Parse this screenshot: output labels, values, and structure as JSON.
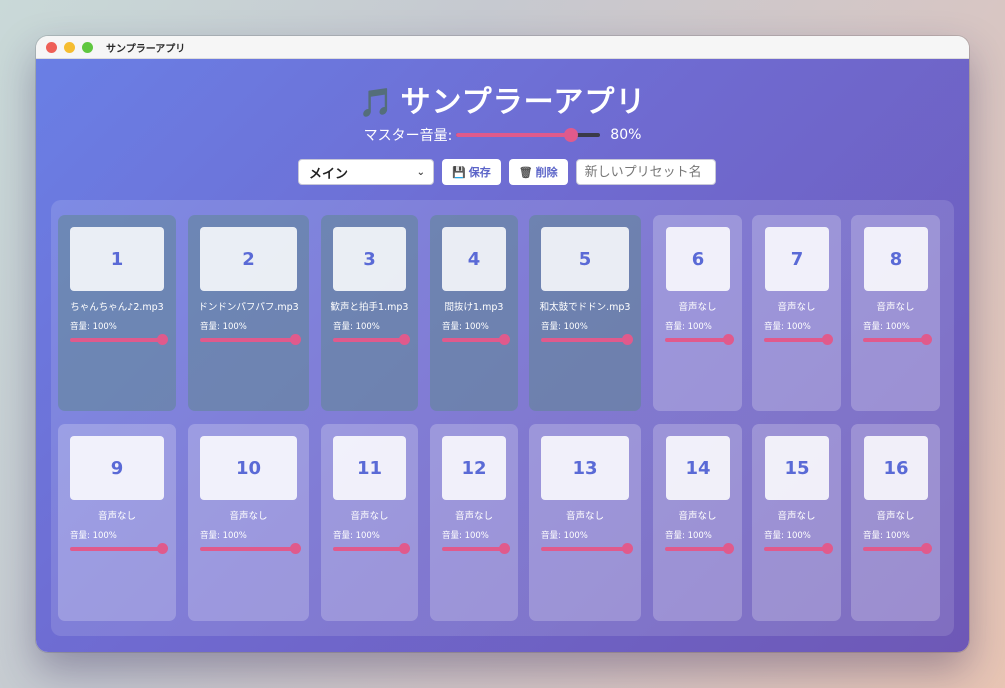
{
  "window": {
    "title": "サンプラーアプリ"
  },
  "app": {
    "title": "サンプラーアプリ",
    "icon": "musical-note-icon"
  },
  "master": {
    "label": "マスター音量:",
    "value_percent": 80,
    "value_text": "80%"
  },
  "toolbar": {
    "preset_selected": "メイン",
    "save_label": "保存",
    "delete_label": "削除",
    "new_preset_placeholder": "新しいプリセット名"
  },
  "colors": {
    "accent": "#e05a8c",
    "pad_number": "#5a6ad6"
  },
  "pads": [
    {
      "number": "1",
      "name": "ちゃんちゃん♪2.mp3",
      "volume_label": "音量: 100%",
      "volume": 100,
      "loaded": true
    },
    {
      "number": "2",
      "name": "ドンドンパフパフ.mp3",
      "volume_label": "音量: 100%",
      "volume": 100,
      "loaded": true
    },
    {
      "number": "3",
      "name": "歓声と拍手1.mp3",
      "volume_label": "音量: 100%",
      "volume": 100,
      "loaded": true
    },
    {
      "number": "4",
      "name": "間抜け1.mp3",
      "volume_label": "音量: 100%",
      "volume": 100,
      "loaded": true
    },
    {
      "number": "5",
      "name": "和太鼓でドドン.mp3",
      "volume_label": "音量: 100%",
      "volume": 100,
      "loaded": true
    },
    {
      "number": "6",
      "name": "音声なし",
      "volume_label": "音量: 100%",
      "volume": 100,
      "loaded": false
    },
    {
      "number": "7",
      "name": "音声なし",
      "volume_label": "音量: 100%",
      "volume": 100,
      "loaded": false
    },
    {
      "number": "8",
      "name": "音声なし",
      "volume_label": "音量: 100%",
      "volume": 100,
      "loaded": false
    },
    {
      "number": "9",
      "name": "音声なし",
      "volume_label": "音量: 100%",
      "volume": 100,
      "loaded": false
    },
    {
      "number": "10",
      "name": "音声なし",
      "volume_label": "音量: 100%",
      "volume": 100,
      "loaded": false
    },
    {
      "number": "11",
      "name": "音声なし",
      "volume_label": "音量: 100%",
      "volume": 100,
      "loaded": false
    },
    {
      "number": "12",
      "name": "音声なし",
      "volume_label": "音量: 100%",
      "volume": 100,
      "loaded": false
    },
    {
      "number": "13",
      "name": "音声なし",
      "volume_label": "音量: 100%",
      "volume": 100,
      "loaded": false
    },
    {
      "number": "14",
      "name": "音声なし",
      "volume_label": "音量: 100%",
      "volume": 100,
      "loaded": false
    },
    {
      "number": "15",
      "name": "音声なし",
      "volume_label": "音量: 100%",
      "volume": 100,
      "loaded": false
    },
    {
      "number": "16",
      "name": "音声なし",
      "volume_label": "音量: 100%",
      "volume": 100,
      "loaded": false
    }
  ]
}
